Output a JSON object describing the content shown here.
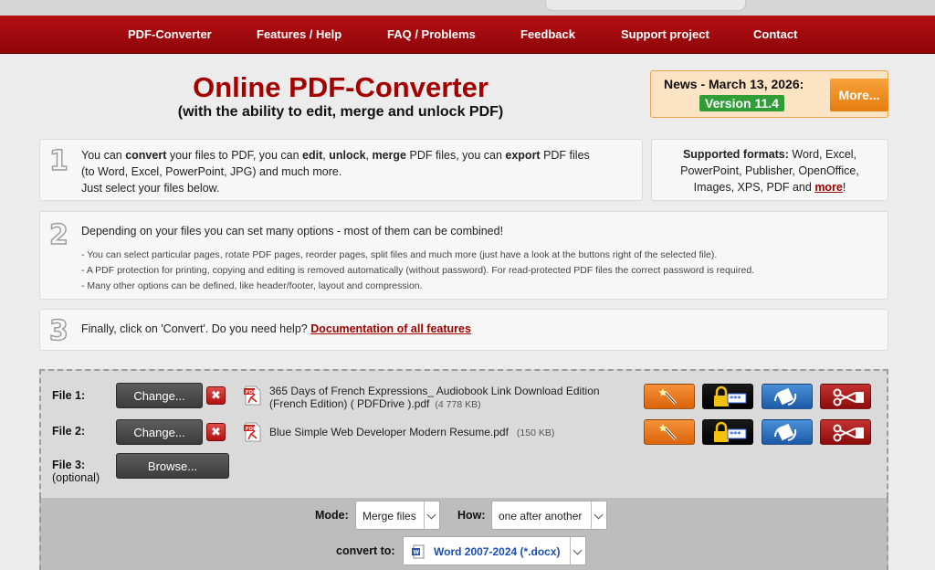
{
  "nav": {
    "items": [
      "PDF-Converter",
      "Features / Help",
      "FAQ / Problems",
      "Feedback",
      "Support project",
      "Contact"
    ]
  },
  "header": {
    "title": "Online PDF-Converter",
    "subtitle": "(with the ability to edit, merge and unlock PDF)"
  },
  "news": {
    "text": "News - March 13, 2026:",
    "version": "Version 11.4",
    "more_label": "More..."
  },
  "step1": {
    "number": "1",
    "line1_a": "You can ",
    "line1_b": "convert",
    "line1_c": " your files to PDF, you can ",
    "line1_d": "edit",
    "line1_e": ", ",
    "line1_f": "unlock",
    "line1_g": ", ",
    "line1_h": "merge",
    "line1_i": " PDF files, you can ",
    "line1_j": "export",
    "line1_k": " PDF files",
    "line2": "(to Word, Excel, PowerPoint, JPG) and much more.",
    "line3": "Just select your files below."
  },
  "formats": {
    "label": "Supported formats:",
    "line1_rest": " Word, Excel,",
    "line2": "PowerPoint, Publisher, OpenOffice,",
    "line3": "Images, XPS, PDF and ",
    "more_link": "more",
    "bang": "!"
  },
  "step2": {
    "number": "2",
    "text": "Depending on your files you can set many options - most of them can be combined!",
    "sub": [
      "- You can select particular pages, rotate PDF pages, reorder pages, split files and much more (just have a look at the buttons right of the selected file).",
      "- A PDF protection for printing, copying and editing is removed automatically (without password). For read-protected PDF files the correct password is required.",
      "- Many other options can be defined, like header/footer, layout and compression."
    ]
  },
  "step3": {
    "number": "3",
    "text": "Finally, click on 'Convert'. Do you need help? ",
    "link": "Documentation of all features"
  },
  "files": [
    {
      "label": "File 1:",
      "change": "Change...",
      "remove": "✖",
      "name_line1": "365 Days of French Expressions_ Audiobook Link Download Edition",
      "name_line2": "(French Edition) ( PDFDrive ).pdf",
      "size": "(4 778 KB)"
    },
    {
      "label": "File 2:",
      "change": "Change...",
      "remove": "✖",
      "name_line1": "Blue Simple Web Developer Modern Resume.pdf",
      "size": "(150 KB)"
    },
    {
      "label": "File 3:",
      "optional": "(optional)",
      "browse": "Browse..."
    }
  ],
  "options": {
    "mode_label": "Mode:",
    "mode_value": "Merge files",
    "how_label": "How:",
    "how_value": "one after another",
    "convert_label": "convert to:",
    "convert_value": "Word 2007-2024 (*.docx)"
  },
  "icons": {
    "edit": "magic-wand-icon",
    "lock": "password-lock-icon",
    "rotate": "rotate-pages-icon",
    "split": "scissors-icon",
    "file": "pdf-file-icon"
  },
  "colors": {
    "nav": "#a30a0e",
    "title": "#a40000",
    "accent_orange": "#e67d0e",
    "version_green": "#2f9e36"
  }
}
